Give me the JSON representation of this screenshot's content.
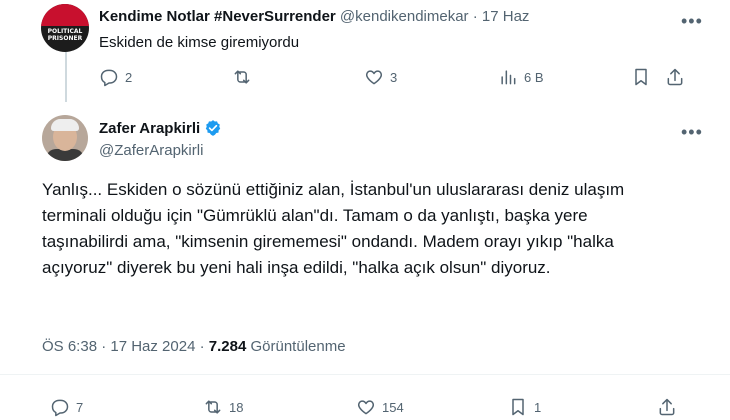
{
  "reply_tweet": {
    "avatar_text": "POLITICAL PRISONER",
    "author_name": "Kendime Notlar #NeverSurrender",
    "author_handle": "@kendikendimekar",
    "separator": "·",
    "date": "17 Haz",
    "text": "Eskiden de kimse giremiyordu",
    "actions": {
      "replies": "2",
      "reposts": "",
      "likes": "3",
      "views": "6 B"
    }
  },
  "main_tweet": {
    "author_name": "Zafer Arapkirli",
    "author_handle": "@ZaferArapkirli",
    "verified_color": "#1d9bf0",
    "text": "Yanlış... Eskiden o sözünü ettiğiniz alan, İstanbul'un uluslararası deniz ulaşım terminali olduğu için \"Gümrüklü alan\"dı. Tamam o da yanlıştı, başka yere taşınabilirdi ama, \"kimsenin girememesi\" ondandı. Madem orayı yıkıp \"halka açıyoruz\" diyerek bu yeni hali inşa edildi, \"halka açık olsun\" diyoruz.",
    "timestamp": "ÖS 6:38 · 17 Haz 2024",
    "meta_separator": " · ",
    "views_count": "7.284",
    "views_label": " Görüntülenme",
    "actions": {
      "replies": "7",
      "reposts": "18",
      "likes": "154",
      "bookmarks": "1"
    }
  },
  "icons": [
    "reply-icon",
    "repost-icon",
    "like-icon",
    "views-icon",
    "bookmark-icon",
    "share-icon",
    "more-icon",
    "verified-badge-icon"
  ]
}
